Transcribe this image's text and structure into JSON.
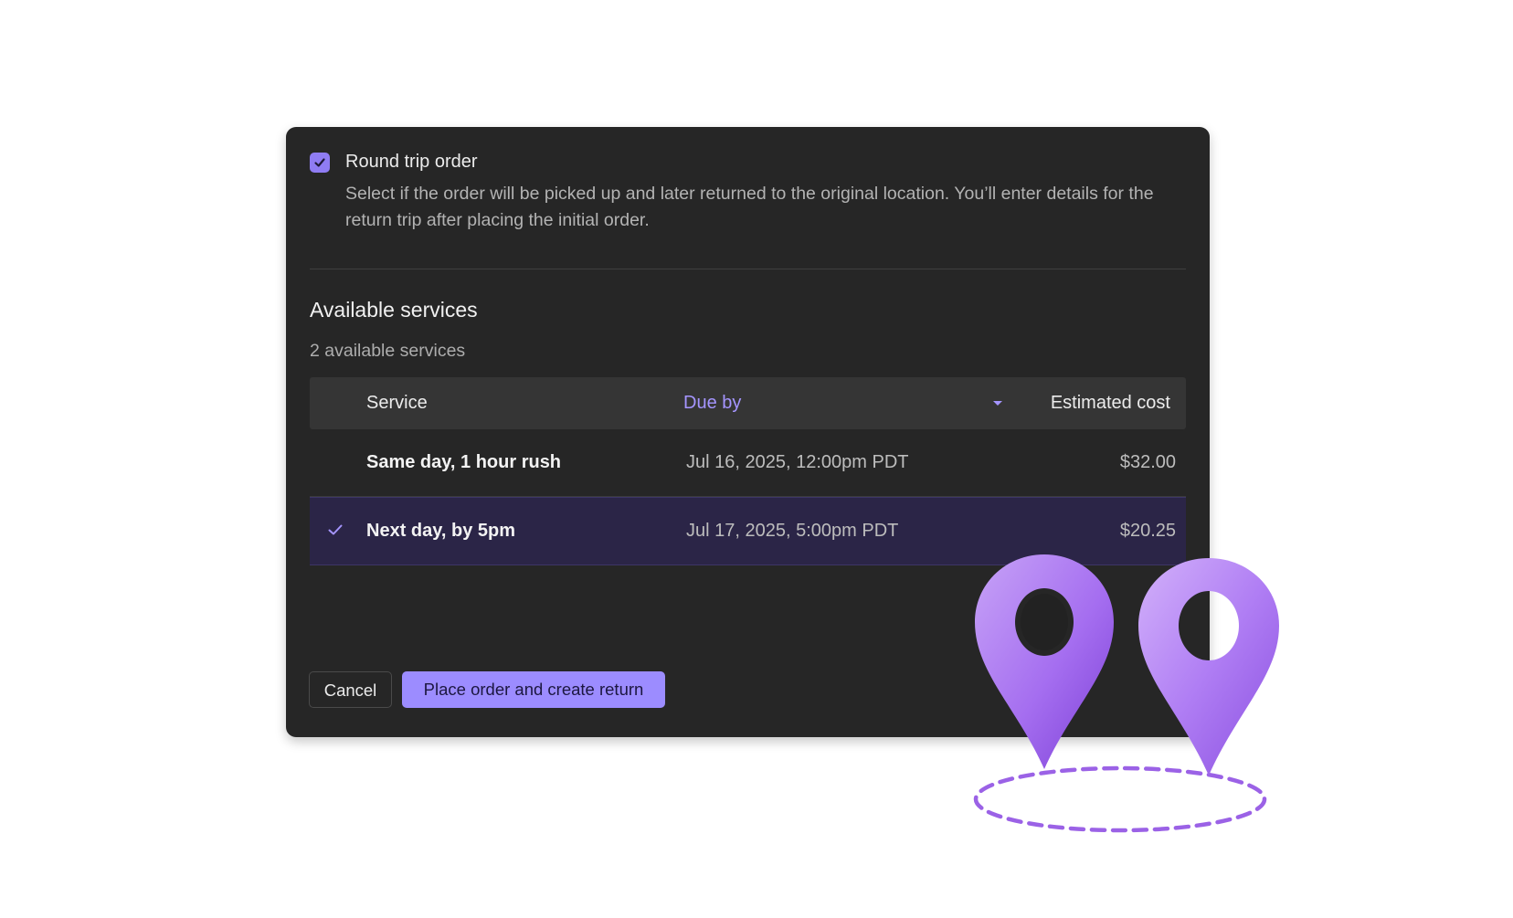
{
  "round_trip": {
    "label": "Round trip order",
    "checked": true,
    "description": "Select if the order will be picked up and later returned to the original location. You’ll enter details for the return trip after placing the initial order."
  },
  "services": {
    "title": "Available services",
    "count_text": "2 available services",
    "columns": {
      "service": "Service",
      "due_by": "Due by",
      "estimated_cost": "Estimated cost"
    },
    "rows": [
      {
        "service": "Same day, 1 hour rush",
        "due_by": "Jul 16, 2025, 12:00pm PDT",
        "cost": "$32.00",
        "selected": false
      },
      {
        "service": "Next day, by 5pm",
        "due_by": "Jul 17, 2025, 5:00pm PDT",
        "cost": "$20.25",
        "selected": true
      }
    ]
  },
  "actions": {
    "cancel": "Cancel",
    "primary": "Place order and create return"
  },
  "colors": {
    "accent": "#9c8cff",
    "dialog_bg": "#262626",
    "selected_row_bg": "#2b2547"
  },
  "icons": {
    "checkbox": "check-icon",
    "sort": "caret-down-icon",
    "row_selected": "check-icon",
    "decoration": "location-pin-icon"
  }
}
